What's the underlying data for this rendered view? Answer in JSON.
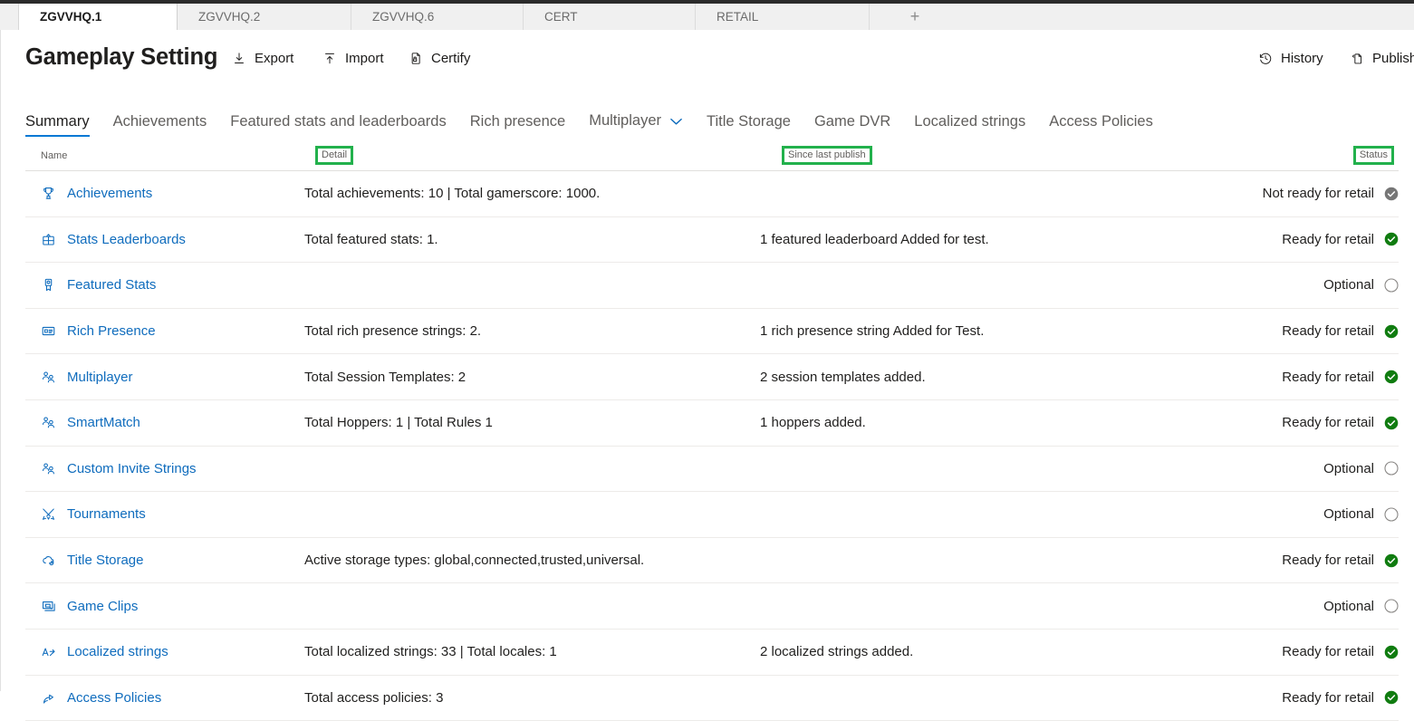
{
  "browser_tabs": [
    {
      "label": "ZGVVHQ.1",
      "active": true
    },
    {
      "label": "ZGVVHQ.2",
      "active": false
    },
    {
      "label": "ZGVVHQ.6",
      "active": false
    },
    {
      "label": "CERT",
      "active": false
    },
    {
      "label": "RETAIL",
      "active": false
    },
    {
      "label": "+",
      "active": false
    }
  ],
  "header": {
    "title": "Gameplay Setting",
    "commands": [
      {
        "label": "Export",
        "icon": "download-icon"
      },
      {
        "label": "Import",
        "icon": "upload-icon"
      },
      {
        "label": "Certify",
        "icon": "certificate-icon"
      }
    ],
    "right_commands": [
      {
        "label": "History",
        "icon": "history-icon"
      },
      {
        "label": "Publish",
        "icon": "publish-icon"
      }
    ]
  },
  "pivots": [
    {
      "label": "Summary",
      "selected": true,
      "chevron": false
    },
    {
      "label": "Achievements",
      "selected": false,
      "chevron": false
    },
    {
      "label": "Featured stats and leaderboards",
      "selected": false,
      "chevron": false
    },
    {
      "label": "Rich presence",
      "selected": false,
      "chevron": false
    },
    {
      "label": "Multiplayer",
      "selected": false,
      "chevron": true
    },
    {
      "label": "Title Storage",
      "selected": false,
      "chevron": false
    },
    {
      "label": "Game DVR",
      "selected": false,
      "chevron": false
    },
    {
      "label": "Localized strings",
      "selected": false,
      "chevron": false
    },
    {
      "label": "Access Policies",
      "selected": false,
      "chevron": false
    }
  ],
  "table": {
    "columns": {
      "name": "Name",
      "detail": "Detail",
      "since_last_publish": "Since last publish",
      "status": "Status"
    },
    "highlight_color": "#22b14c",
    "highlighted_columns": [
      "detail",
      "since_last_publish",
      "status"
    ],
    "rows": [
      {
        "icon": "trophy-icon",
        "name": "Achievements",
        "detail": "Total achievements: 10 | Total gamerscore: 1000.",
        "since_last_publish": "",
        "status": "Not ready for retail",
        "status_kind": "gray-check"
      },
      {
        "icon": "leaderboard-grid-icon",
        "name": "Stats Leaderboards",
        "detail": "Total featured stats: 1.",
        "since_last_publish": "1 featured leaderboard Added for test.",
        "status": "Ready for retail",
        "status_kind": "green-check"
      },
      {
        "icon": "ribbon-icon",
        "name": "Featured Stats",
        "detail": "",
        "since_last_publish": "",
        "status": "Optional",
        "status_kind": "empty-circle"
      },
      {
        "icon": "id-card-icon",
        "name": "Rich Presence",
        "detail": "Total rich presence strings: 2.",
        "since_last_publish": "1 rich presence string Added for Test.",
        "status": "Ready for retail",
        "status_kind": "green-check"
      },
      {
        "icon": "people-icon",
        "name": "Multiplayer",
        "detail": "Total Session Templates: 2",
        "since_last_publish": "2 session templates added.",
        "status": "Ready for retail",
        "status_kind": "green-check"
      },
      {
        "icon": "people-icon",
        "name": "SmartMatch",
        "detail": "Total Hoppers: 1 | Total Rules 1",
        "since_last_publish": "1 hoppers added.",
        "status": "Ready for retail",
        "status_kind": "green-check"
      },
      {
        "icon": "people-icon",
        "name": "Custom Invite Strings",
        "detail": "",
        "since_last_publish": "",
        "status": "Optional",
        "status_kind": "empty-circle"
      },
      {
        "icon": "tournament-icon",
        "name": "Tournaments",
        "detail": "",
        "since_last_publish": "",
        "status": "Optional",
        "status_kind": "empty-circle"
      },
      {
        "icon": "cloud-storage-icon",
        "name": "Title Storage",
        "detail": "Active storage types: global,connected,trusted,universal.",
        "since_last_publish": "",
        "status": "Ready for retail",
        "status_kind": "green-check"
      },
      {
        "icon": "game-clip-icon",
        "name": "Game Clips",
        "detail": "",
        "since_last_publish": "",
        "status": "Optional",
        "status_kind": "empty-circle"
      },
      {
        "icon": "translate-icon",
        "name": "Localized strings",
        "detail": "Total localized strings: 33 | Total locales: 1",
        "since_last_publish": "2 localized strings added.",
        "status": "Ready for retail",
        "status_kind": "green-check"
      },
      {
        "icon": "share-policy-icon",
        "name": "Access Policies",
        "detail": "Total access policies: 3",
        "since_last_publish": "",
        "status": "Ready for retail",
        "status_kind": "green-check"
      }
    ]
  }
}
